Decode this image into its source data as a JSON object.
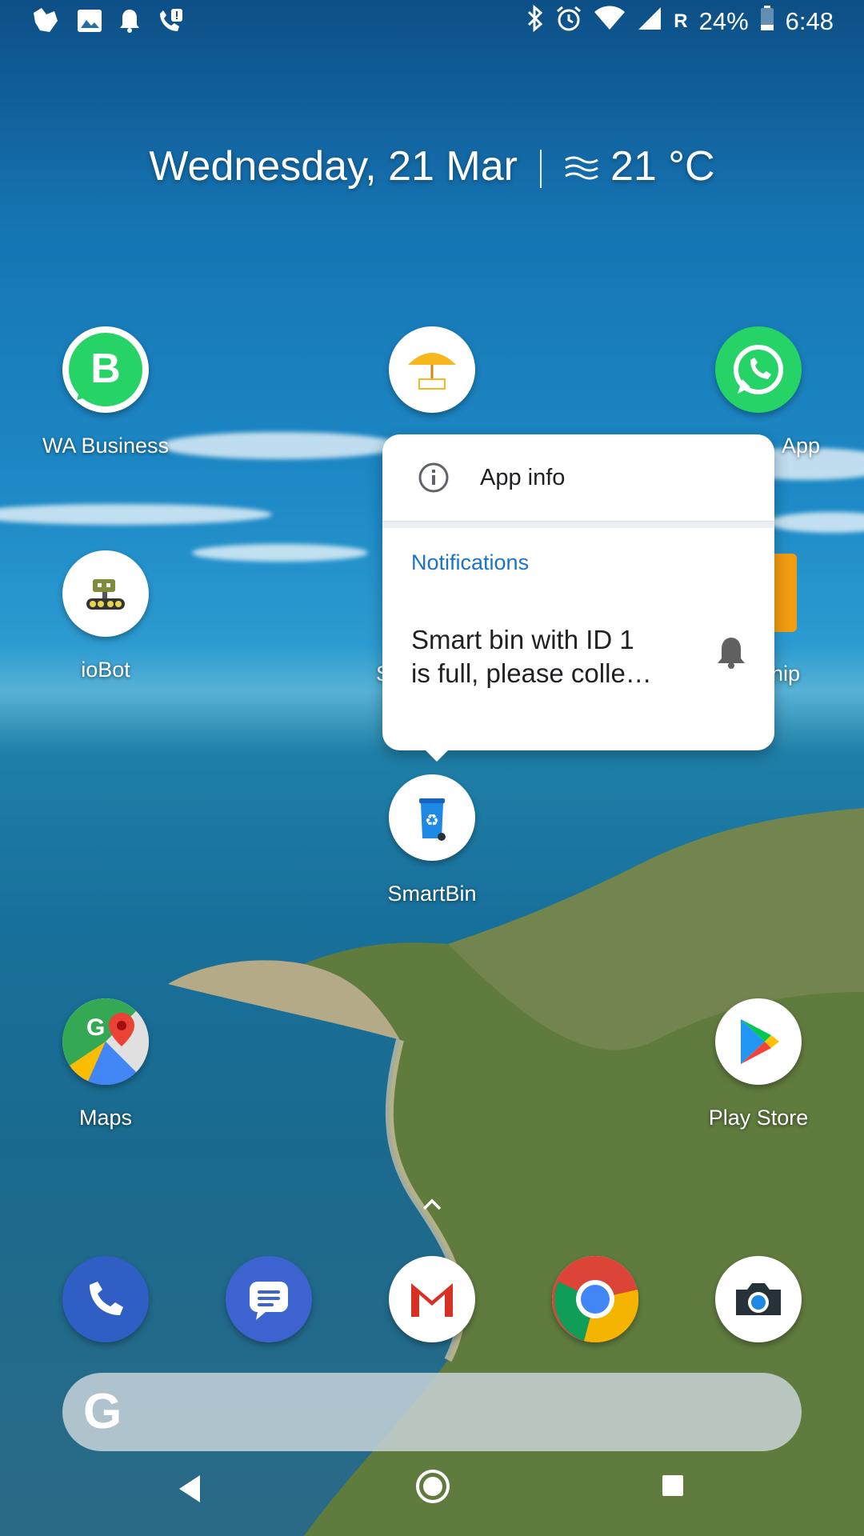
{
  "status_bar": {
    "left_icons": [
      "assistant-icon",
      "image-icon",
      "bell-icon",
      "wifi-call-alert-icon"
    ],
    "right_icons": [
      "bluetooth-icon",
      "alarm-icon",
      "wifi-icon",
      "signal-icon"
    ],
    "roaming": "R",
    "battery": "24%",
    "time": "6:48"
  },
  "glance": {
    "date": "Wednesday, 21 Mar",
    "weather_icon": "haze-icon",
    "temperature": "21 °C"
  },
  "apps": {
    "wa_business": "WA Business",
    "pune_app": "",
    "whatsapp": "App",
    "iobot": "ioBot",
    "hidden_middle": "S",
    "hidden_right": "hip",
    "smartbin": "SmartBin",
    "maps": "Maps",
    "play_store": "Play Store"
  },
  "popup": {
    "app_info": "App info",
    "notifications_title": "Notifications",
    "notification_line1": "Smart bin with ID 1",
    "notification_line2": "is full, please colle…"
  },
  "dock": [
    "phone-icon",
    "messages-icon",
    "gmail-icon",
    "chrome-icon",
    "camera-icon"
  ],
  "search": {
    "logo": "G"
  },
  "nav": [
    "back-icon",
    "home-icon",
    "recents-icon"
  ],
  "colors": {
    "accent": "#1a73c8",
    "whatsapp_green": "#25d366",
    "gmail_red": "#d93025"
  }
}
